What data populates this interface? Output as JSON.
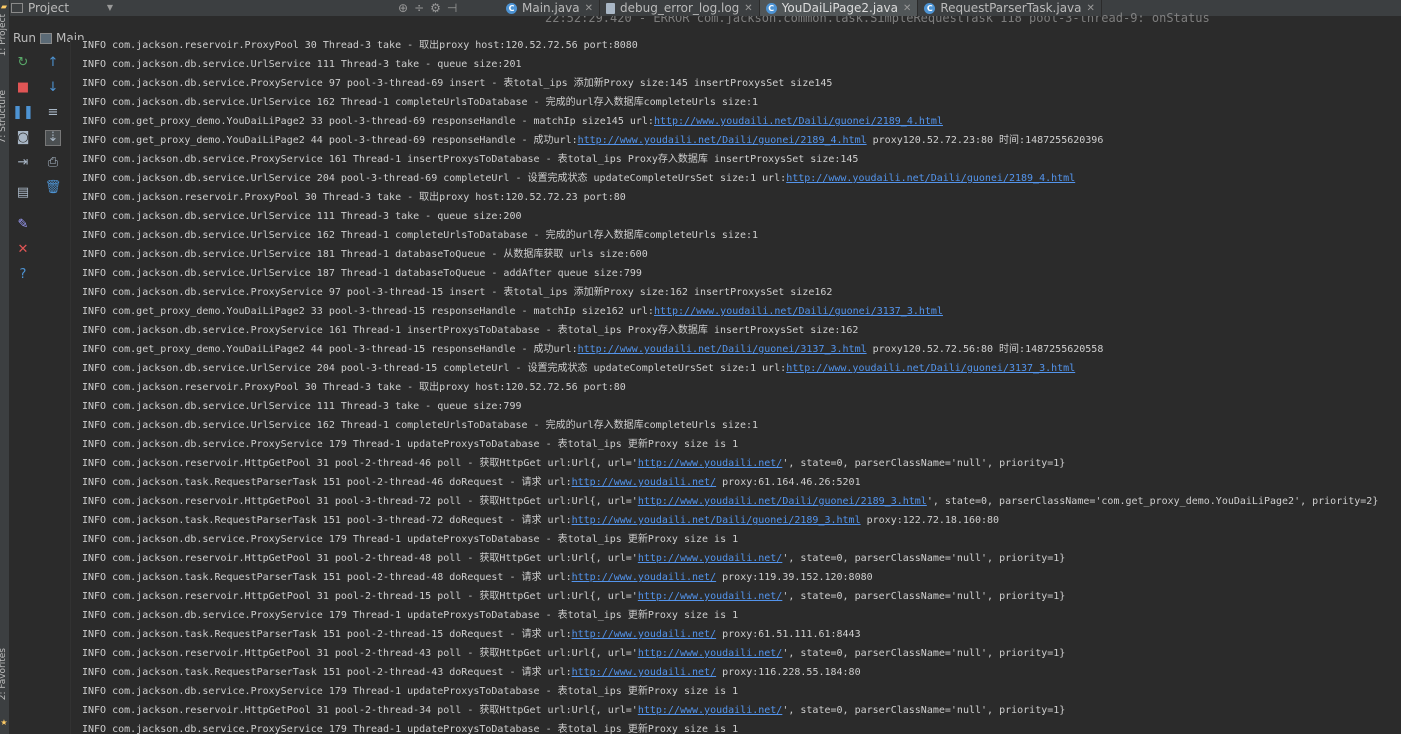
{
  "left_strip": {
    "top_label": "1: Project",
    "mid_label": "7: Structure",
    "bottom_label": "2: Favorites"
  },
  "project_panel": {
    "label": "Project"
  },
  "tabs": [
    {
      "label": "Main.java",
      "icon": "class-icon",
      "active": false
    },
    {
      "label": "debug_error_log.log",
      "icon": "file-icon",
      "active": false
    },
    {
      "label": "YouDaiLiPage2.java",
      "icon": "class-icon",
      "active": true
    },
    {
      "label": "RequestParserTask.java",
      "icon": "class-icon",
      "active": false
    }
  ],
  "background_text": "22:52:29.420 - ERROR com.jackson.common.task.SimpleRequestTask 118 pool-3-thread-9: onStatus",
  "run_bar": {
    "run_label": "Run",
    "config_label": "Main"
  },
  "toolbar_icons": [
    {
      "name": "rerun-icon",
      "glyph": "↻",
      "color": "#59a869"
    },
    {
      "name": "up-arrow-icon",
      "glyph": "↑",
      "color": "#4d93d3"
    },
    {
      "name": "stop-icon",
      "glyph": "■",
      "color": "#e05555"
    },
    {
      "name": "down-arrow-icon",
      "glyph": "↓",
      "color": "#4d93d3"
    },
    {
      "name": "pause-icon",
      "glyph": "❚❚",
      "color": "#4d93d3"
    },
    {
      "name": "soft-wrap-icon",
      "glyph": "≡",
      "color": "#a9b7c6"
    },
    {
      "name": "camera-icon",
      "glyph": "◙",
      "color": "#a9b7c6"
    },
    {
      "name": "scroll-to-end-icon",
      "glyph": "⇣",
      "color": "#a9b7c6"
    },
    {
      "name": "login-icon",
      "glyph": "⇥",
      "color": "#a9b7c6"
    },
    {
      "name": "print-icon",
      "glyph": "⎙",
      "color": "#a9b7c6"
    },
    {
      "name": "layout-icon",
      "glyph": "▤",
      "color": "#a9b7c6"
    },
    {
      "name": "trash-icon",
      "glyph": "🗑",
      "color": "#4d93d3"
    },
    {
      "name": "pin-icon",
      "glyph": "✎",
      "color": "#a0a0ff"
    },
    {
      "name": "close-icon",
      "glyph": "✕",
      "color": "#e05555"
    },
    {
      "name": "help-icon",
      "glyph": "?",
      "color": "#4d93d3"
    }
  ],
  "console_lines": [
    [
      {
        "t": "INFO  com.jackson.reservoir.ProxyPool 30 Thread-3 take - 取出proxy host:120.52.72.56 port:8080"
      }
    ],
    [
      {
        "t": "INFO  com.jackson.db.service.UrlService 111 Thread-3 take - queue size:201"
      }
    ],
    [
      {
        "t": "INFO  com.jackson.db.service.ProxyService 97 pool-3-thread-69 insert - 表total_ips 添加新Proxy size:145 insertProxysSet size145"
      }
    ],
    [
      {
        "t": "INFO  com.jackson.db.service.UrlService 162 Thread-1 completeUrlsToDatabase - 完成的url存入数据库completeUrls size:1"
      }
    ],
    [
      {
        "t": "INFO  com.get_proxy_demo.YouDaiLiPage2 33 pool-3-thread-69 responseHandle - matchIp size145 url:"
      },
      {
        "t": "http://www.youdaili.net/Daili/guonei/2189_4.html",
        "link": true
      }
    ],
    [
      {
        "t": "INFO  com.get_proxy_demo.YouDaiLiPage2 44 pool-3-thread-69 responseHandle - 成功url:"
      },
      {
        "t": "http://www.youdaili.net/Daili/guonei/2189_4.html",
        "link": true
      },
      {
        "t": " proxy120.52.72.23:80 时间:1487255620396"
      }
    ],
    [
      {
        "t": "INFO  com.jackson.db.service.ProxyService 161 Thread-1 insertProxysToDatabase - 表total_ips Proxy存入数据库 insertProxysSet size:145"
      }
    ],
    [
      {
        "t": "INFO  com.jackson.db.service.UrlService 204 pool-3-thread-69 completeUrl - 设置完成状态 updateCompleteUrsSet size:1 url:"
      },
      {
        "t": "http://www.youdaili.net/Daili/guonei/2189_4.html",
        "link": true
      }
    ],
    [
      {
        "t": "INFO  com.jackson.reservoir.ProxyPool 30 Thread-3 take - 取出proxy host:120.52.72.23 port:80"
      }
    ],
    [
      {
        "t": "INFO  com.jackson.db.service.UrlService 111 Thread-3 take - queue size:200"
      }
    ],
    [
      {
        "t": "INFO  com.jackson.db.service.UrlService 162 Thread-1 completeUrlsToDatabase - 完成的url存入数据库completeUrls size:1"
      }
    ],
    [
      {
        "t": "INFO  com.jackson.db.service.UrlService 181 Thread-1 databaseToQueue - 从数据库获取 urls size:600"
      }
    ],
    [
      {
        "t": "INFO  com.jackson.db.service.UrlService 187 Thread-1 databaseToQueue - addAfter queue size:799"
      }
    ],
    [
      {
        "t": "INFO  com.jackson.db.service.ProxyService 97 pool-3-thread-15 insert - 表total_ips 添加新Proxy size:162 insertProxysSet size162"
      }
    ],
    [
      {
        "t": "INFO  com.get_proxy_demo.YouDaiLiPage2 33 pool-3-thread-15 responseHandle - matchIp size162 url:"
      },
      {
        "t": "http://www.youdaili.net/Daili/guonei/3137_3.html",
        "link": true
      }
    ],
    [
      {
        "t": "INFO  com.jackson.db.service.ProxyService 161 Thread-1 insertProxysToDatabase - 表total_ips Proxy存入数据库 insertProxysSet size:162"
      }
    ],
    [
      {
        "t": "INFO  com.get_proxy_demo.YouDaiLiPage2 44 pool-3-thread-15 responseHandle - 成功url:"
      },
      {
        "t": "http://www.youdaili.net/Daili/guonei/3137_3.html",
        "link": true
      },
      {
        "t": " proxy120.52.72.56:80 时间:1487255620558"
      }
    ],
    [
      {
        "t": "INFO  com.jackson.db.service.UrlService 204 pool-3-thread-15 completeUrl - 设置完成状态 updateCompleteUrsSet size:1 url:"
      },
      {
        "t": "http://www.youdaili.net/Daili/guonei/3137_3.html",
        "link": true
      }
    ],
    [
      {
        "t": "INFO  com.jackson.reservoir.ProxyPool 30 Thread-3 take - 取出proxy host:120.52.72.56 port:80"
      }
    ],
    [
      {
        "t": "INFO  com.jackson.db.service.UrlService 111 Thread-3 take - queue size:799"
      }
    ],
    [
      {
        "t": "INFO  com.jackson.db.service.UrlService 162 Thread-1 completeUrlsToDatabase - 完成的url存入数据库completeUrls size:1"
      }
    ],
    [
      {
        "t": "INFO  com.jackson.db.service.ProxyService 179 Thread-1 updateProxysToDatabase - 表total_ips 更新Proxy size is 1"
      }
    ],
    [
      {
        "t": "INFO  com.jackson.reservoir.HttpGetPool 31 pool-2-thread-46 poll - 获取HttpGet url:Url{, url='"
      },
      {
        "t": "http://www.youdaili.net/",
        "link": true
      },
      {
        "t": "', state=0, parserClassName='null', priority=1}"
      }
    ],
    [
      {
        "t": "INFO  com.jackson.task.RequestParserTask 151 pool-2-thread-46 doRequest - 请求 url:"
      },
      {
        "t": "http://www.youdaili.net/",
        "link": true
      },
      {
        "t": " proxy:61.164.46.26:5201"
      }
    ],
    [
      {
        "t": "INFO  com.jackson.reservoir.HttpGetPool 31 pool-3-thread-72 poll - 获取HttpGet url:Url{, url='"
      },
      {
        "t": "http://www.youdaili.net/Daili/guonei/2189_3.html",
        "link": true
      },
      {
        "t": "', state=0, parserClassName='com.get_proxy_demo.YouDaiLiPage2', priority=2}"
      }
    ],
    [
      {
        "t": "INFO  com.jackson.task.RequestParserTask 151 pool-3-thread-72 doRequest - 请求 url:"
      },
      {
        "t": "http://www.youdaili.net/Daili/guonei/2189_3.html",
        "link": true
      },
      {
        "t": " proxy:122.72.18.160:80"
      }
    ],
    [
      {
        "t": "INFO  com.jackson.db.service.ProxyService 179 Thread-1 updateProxysToDatabase - 表total_ips 更新Proxy size is 1"
      }
    ],
    [
      {
        "t": "INFO  com.jackson.reservoir.HttpGetPool 31 pool-2-thread-48 poll - 获取HttpGet url:Url{, url='"
      },
      {
        "t": "http://www.youdaili.net/",
        "link": true
      },
      {
        "t": "', state=0, parserClassName='null', priority=1}"
      }
    ],
    [
      {
        "t": "INFO  com.jackson.task.RequestParserTask 151 pool-2-thread-48 doRequest - 请求 url:"
      },
      {
        "t": "http://www.youdaili.net/",
        "link": true
      },
      {
        "t": " proxy:119.39.152.120:8080"
      }
    ],
    [
      {
        "t": "INFO  com.jackson.reservoir.HttpGetPool 31 pool-2-thread-15 poll - 获取HttpGet url:Url{, url='"
      },
      {
        "t": "http://www.youdaili.net/",
        "link": true
      },
      {
        "t": "', state=0, parserClassName='null', priority=1}"
      }
    ],
    [
      {
        "t": "INFO  com.jackson.db.service.ProxyService 179 Thread-1 updateProxysToDatabase - 表total_ips 更新Proxy size is 1"
      }
    ],
    [
      {
        "t": "INFO  com.jackson.task.RequestParserTask 151 pool-2-thread-15 doRequest - 请求 url:"
      },
      {
        "t": "http://www.youdaili.net/",
        "link": true
      },
      {
        "t": " proxy:61.51.111.61:8443"
      }
    ],
    [
      {
        "t": "INFO  com.jackson.reservoir.HttpGetPool 31 pool-2-thread-43 poll - 获取HttpGet url:Url{, url='"
      },
      {
        "t": "http://www.youdaili.net/",
        "link": true
      },
      {
        "t": "', state=0, parserClassName='null', priority=1}"
      }
    ],
    [
      {
        "t": "INFO  com.jackson.task.RequestParserTask 151 pool-2-thread-43 doRequest - 请求 url:"
      },
      {
        "t": "http://www.youdaili.net/",
        "link": true
      },
      {
        "t": " proxy:116.228.55.184:80"
      }
    ],
    [
      {
        "t": "INFO  com.jackson.db.service.ProxyService 179 Thread-1 updateProxysToDatabase - 表total_ips 更新Proxy size is 1"
      }
    ],
    [
      {
        "t": "INFO  com.jackson.reservoir.HttpGetPool 31 pool-2-thread-34 poll - 获取HttpGet url:Url{, url='"
      },
      {
        "t": "http://www.youdaili.net/",
        "link": true
      },
      {
        "t": "', state=0, parserClassName='null', priority=1}"
      }
    ],
    [
      {
        "t": "INFO  com.jackson.db.service.ProxyService 179 Thread-1 updateProxysToDatabase - 表total_ips 更新Proxy size is 1"
      }
    ]
  ]
}
